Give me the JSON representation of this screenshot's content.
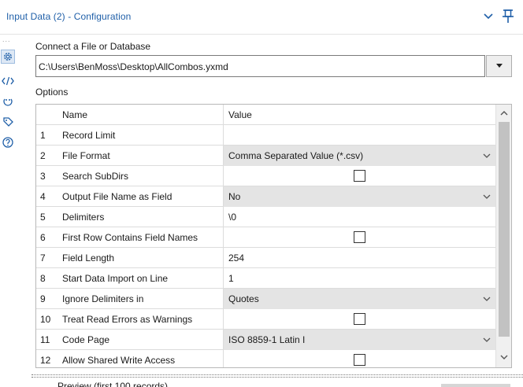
{
  "window": {
    "title": "Input Data (2) - Configuration",
    "collapse_icon": "chevron-down-icon",
    "pin_icon": "pin-icon",
    "accent_color": "#1f5fa8"
  },
  "rail": {
    "grip": "...",
    "icons": [
      "gear-icon",
      "code-icon",
      "connection-icon",
      "tag-icon",
      "help-icon"
    ]
  },
  "connect": {
    "label": "Connect a File or Database",
    "value": "C:\\Users\\BenMoss\\Desktop\\AllCombos.yxmd"
  },
  "options": {
    "label": "Options",
    "headers": {
      "num": "",
      "name": "Name",
      "value": "Value"
    },
    "rows": [
      {
        "num": "1",
        "name": "Record Limit",
        "type": "text",
        "value": ""
      },
      {
        "num": "2",
        "name": "File Format",
        "type": "dropdown",
        "value": "Comma Separated Value (*.csv)"
      },
      {
        "num": "3",
        "name": "Search SubDirs",
        "type": "checkbox",
        "checked": false
      },
      {
        "num": "4",
        "name": "Output File Name as Field",
        "type": "dropdown",
        "value": "No"
      },
      {
        "num": "5",
        "name": "Delimiters",
        "type": "text",
        "value": "\\0"
      },
      {
        "num": "6",
        "name": "First Row Contains Field Names",
        "type": "checkbox",
        "checked": false
      },
      {
        "num": "7",
        "name": "Field Length",
        "type": "text",
        "value": "254"
      },
      {
        "num": "8",
        "name": "Start Data Import on Line",
        "type": "text",
        "value": "1"
      },
      {
        "num": "9",
        "name": "Ignore Delimiters in",
        "type": "dropdown",
        "value": "Quotes"
      },
      {
        "num": "10",
        "name": "Treat Read Errors as Warnings",
        "type": "checkbox",
        "checked": false
      },
      {
        "num": "11",
        "name": "Code Page",
        "type": "dropdown",
        "value": "ISO 8859-1 Latin I"
      },
      {
        "num": "12",
        "name": "Allow Shared Write Access",
        "type": "checkbox",
        "checked": false
      }
    ]
  },
  "preview": {
    "label": "Preview (first 100 records)"
  }
}
